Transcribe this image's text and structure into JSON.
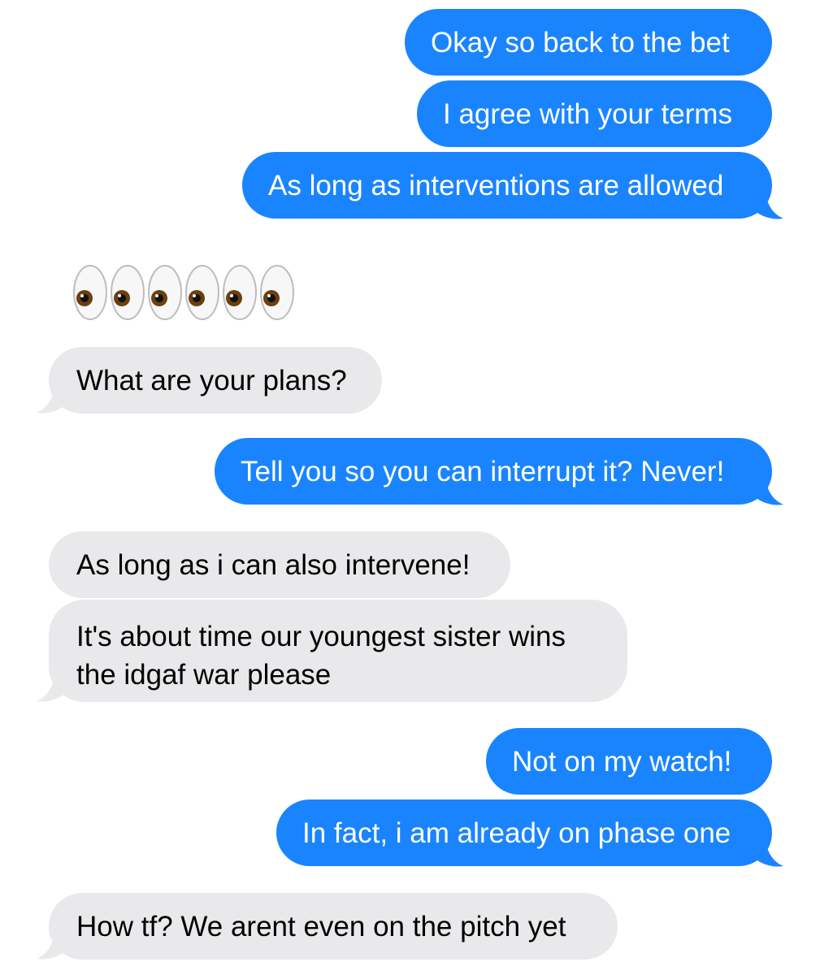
{
  "colors": {
    "outgoing": "#1a84ff",
    "incoming": "#e9e9eb",
    "outgoing_text": "#ffffff",
    "incoming_text": "#000000"
  },
  "messages": [
    {
      "side": "outgoing",
      "text": "Okay so back to the bet"
    },
    {
      "side": "outgoing",
      "text": "I agree with your terms"
    },
    {
      "side": "outgoing",
      "text": "As long as interventions are allowed"
    },
    {
      "side": "incoming",
      "emoji": "eyes-emoji",
      "count": 6
    },
    {
      "side": "incoming",
      "text": "What are your plans?"
    },
    {
      "side": "outgoing",
      "text": "Tell you so you can interrupt it? Never!"
    },
    {
      "side": "incoming",
      "text": "As long as i can also intervene!"
    },
    {
      "side": "incoming",
      "text": "It's about time our youngest sister wins the idgaf war please"
    },
    {
      "side": "outgoing",
      "text": "Not on my watch!"
    },
    {
      "side": "outgoing",
      "text": "In fact, i am already on phase one"
    },
    {
      "side": "incoming",
      "text": "How tf? We arent even on the pitch yet"
    }
  ]
}
